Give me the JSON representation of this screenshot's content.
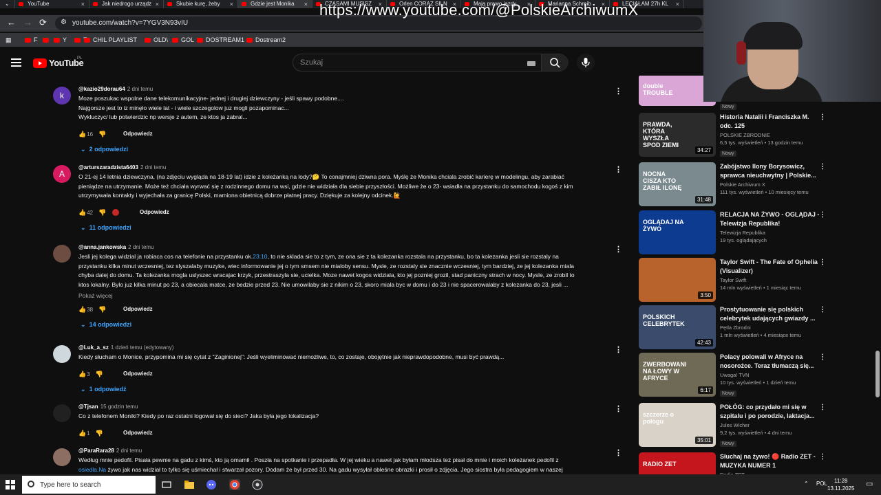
{
  "browser": {
    "tabs": [
      {
        "title": "YouTube",
        "active": false
      },
      {
        "title": "Jak niedrogo urządz",
        "active": false
      },
      {
        "title": "Skubie kurę, żeby",
        "active": false
      },
      {
        "title": "Gdzie jest Monika",
        "active": true
      },
      {
        "title": "CZASAMI MUSISZ",
        "active": false
      },
      {
        "title": "Orlen CORAZ SILN",
        "active": false
      },
      {
        "title": "Mają prawo jazdy",
        "active": false
      },
      {
        "title": "Marianna Schreib",
        "active": false
      },
      {
        "title": "LECIAŁAM 27h KL",
        "active": false
      }
    ],
    "url_overlay": "https://www.youtube.com/@PolskieArchiwumX",
    "address": "youtube.com/watch?v=7YGV3N93vIU",
    "bookmarks": [
      "F",
      "",
      "Y",
      "T",
      "CHIL PLAYLIST",
      "OLD\\",
      "GOL",
      "DOSTREAM1",
      "Dostream2"
    ]
  },
  "youtube": {
    "logo_text": "YouTube",
    "logo_region": "PL",
    "search_placeholder": "Szukaj"
  },
  "comments": [
    {
      "author": "@kazio29dorau64",
      "time": "2 dni temu",
      "avatar_letter": "k",
      "avatar_color": "#5e35b1",
      "lines": [
        "Moze poszukac wspolne dane telekomunikacyjne- jednej i drugiej dziewczyny - jeśli spawy podobne....",
        "Najgorsze jest to iz minęło wiele lat - i wiele szczegolow juz mogli pozapominac...",
        "Wykluczyc/ lub potwierdzic np wersje z autem, ze ktos ja zabral..."
      ],
      "likes": "16",
      "reply_label": "Odpowiedz",
      "replies": "2 odpowiedzi"
    },
    {
      "author": "@arturszaradzista6403",
      "time": "2 dni temu",
      "avatar_letter": "A",
      "avatar_color": "#d81b60",
      "lines": [
        "O 21-ej 14 letnia dziewczyna, (na zdjęciu wygląda na 18-19 lat) idzie z koleżanką na lody?🤔 To conajmniej dziwna pora. Myślę że Monika chciala zrobić karierę w modelingu, aby zarabiać",
        "pieniądze na utrzymanie. Może też chciała wyrwać się z rodzinnego domu na wsi, gdzie nie widziała dla siebie przyszłości. Możliwe że o 23- wsiadła na przystanku do  samochodu kogoś z kim",
        "utrzymywała kontakty i wyjechała za granicę Polski, mamiona obietnicą  dobrze płatnej pracy. Dziękuje za kolejny odcinek.🙋"
      ],
      "likes": "42",
      "reply_label": "Odpowiedz",
      "replies": "11 odpowiedzi"
    },
    {
      "author": "@anna.jankowska",
      "time": "2 dni temu",
      "avatar_letter": "",
      "avatar_color": "#6d4c41",
      "lines": [
        "Jesli jej kolega widzial ja robiaca cos na telefonie na przystanku ok.",
        "23:10",
        ", to nie sklada sie to z tym, ze ona sie z ta kolezanka rozstala na przystanku, bo ta kolezanka jesli sie rozstaly na",
        "przystanku kilka minut wczesniej, tez  slyszalaby muzyke, wiec informowanie jej o tym smsem nie mialoby sensu. Mysle, ze rozstaly sie znacznie wczesniej, tym bardziej, ze jej kolezanka miala",
        "chyba dalej do domu. Ta kolezanka mogla uslyszec wracajac krzyk, przestraszyla sie, ucielka. Moze nawet kogos widziala, kto jej pozniej grozil, stad paniczny strach w nocy. Mysle, ze zrobil to",
        "ktos lokalny. Bylo juz kilka minut po 23, a obiecala matce, ze bedzie przed 23. Nie umowilaby sie z nikim o 23, skoro miala byc w domu i do 23 i nie spacerowalaby z kolezanka do 23, jesli ..."
      ],
      "more": "Pokaż więcej",
      "likes": "38",
      "reply_label": "Odpowiedz",
      "replies": "14 odpowiedzi"
    },
    {
      "author": "@Luk_a_sz",
      "time": "1 dzień temu (edytowany)",
      "avatar_letter": "",
      "avatar_color": "#cfd8dc",
      "lines": [
        "Kiedy słucham o Monice, przypomina mi się cytat z \"Zaginionej\": Jeśli wyeliminować niemożliwe, to, co zostaje, obojętnie jak nieprawdopodobne, musi być prawdą..."
      ],
      "likes": "3",
      "reply_label": "Odpowiedz",
      "replies": "1 odpowiedź"
    },
    {
      "author": "@Tjsan",
      "time": "15 godzin temu",
      "avatar_letter": "",
      "avatar_color": "#212121",
      "lines": [
        "Co z telefonem Moniki? Kiedy po raz ostatni logował się do sieci? Jaka była jego lokalizacja?"
      ],
      "likes": "1",
      "reply_label": "Odpowiedz",
      "replies": ""
    },
    {
      "author": "@ParaRara28",
      "time": "2 dni temu",
      "avatar_letter": "",
      "avatar_color": "#8d6e63",
      "lines": [
        "Według mnie pedofil.  Pisała pewnie na gadu z kimś, kto ją omamił . Poszła na spotkanie i przepadła. W jej wieku a nawet jak byłam młodsza też pisał do mnie i moich koleżanek pedofil z",
        "osiedla.Na",
        " żywo jak nas widział to tylko się uśmiechał i stwarzał pozory. Dodam że był przed 30. Na gadu wysyłał obleśne obrazki i prosił o zdjęcia. Jego siostra była pedagogiem w naszej"
      ],
      "likes": "",
      "reply_label": "",
      "replies": ""
    }
  ],
  "sidebar": [
    {
      "title": "",
      "channel": "",
      "meta": "",
      "badge": "Nowy",
      "duration": "",
      "thumb_caption": "double TROUBLE",
      "thumb_color": "#d9a6d6"
    },
    {
      "title": "Historia Natalii i Franciszka M. odc. 125",
      "channel": "POLSKIE ZBRODNIE",
      "meta": "6,5 tys. wyświetleń • 13 godzin temu",
      "badge": "Nowy",
      "duration": "34:27",
      "thumb_caption": "PRAWDA, KTÓRA WYSZŁA SPOD ZIEMI",
      "thumb_color": "#2b2b2b"
    },
    {
      "title": "Zabójstwo Ilony Borysowicz, sprawca nieuchwytny | Polskie...",
      "channel": "Polskie Archiwum X",
      "meta": "111 tys. wyświetleń • 10 miesięcy temu",
      "badge": "",
      "duration": "31:48",
      "thumb_caption": "NOCNA CISZA KTO ZABIŁ ILONĘ",
      "thumb_color": "#7a8a8f"
    },
    {
      "title": "RELACJA NA ŻYWO - OGLĄDAJ - Telewizja Republika!",
      "channel": "Telewizja Republika",
      "meta": "19 tys. oglądających",
      "badge": "",
      "duration": "",
      "thumb_caption": "OGLĄDAJ NA ŻYWO",
      "thumb_color": "#0d3b8f"
    },
    {
      "title": "Taylor Swift - The Fate of Ophelia (Visualizer)",
      "channel": "Taylor Swift",
      "meta": "14 mln wyświetleń • 1 miesiąc temu",
      "badge": "",
      "duration": "3:50",
      "thumb_caption": "",
      "thumb_color": "#b8622c"
    },
    {
      "title": "Prostytuowanie się polskich celebrytek udających gwiazdy ...",
      "channel": "Pętla Zbrodni",
      "meta": "1 mln wyświetleń • 4 miesiące temu",
      "badge": "",
      "duration": "42:43",
      "thumb_caption": "POLSKICH CELEBRYTEK",
      "thumb_color": "#3a4b6b"
    },
    {
      "title": "Polacy polowali w Afryce na nosorożce. Teraz tłumaczą się...",
      "channel": "Uwaga! TVN",
      "meta": "10 tys. wyświetleń • 1 dzień temu",
      "badge": "Nowy",
      "duration": "6:17",
      "thumb_caption": "ZWERBOWANI NA ŁOWY W AFRYCE",
      "thumb_color": "#6f6a55"
    },
    {
      "title": "POŁÓG: co przydało mi się w szpitalu i po porodzie, laktacja...",
      "channel": "Jules Wicher",
      "meta": "9,2 tys. wyświetleń • 4 dni temu",
      "badge": "Nowy",
      "duration": "35:01",
      "thumb_caption": "szczerze o połogu",
      "thumb_color": "#d8d2c8"
    },
    {
      "title": "Słuchaj na żywo! 🔴 Radio ZET - MUZYKA NUMER 1",
      "channel": "Radio ZET",
      "meta": "",
      "badge": "",
      "duration": "",
      "thumb_caption": "RADIO ZET",
      "thumb_color": "#c4161c"
    }
  ],
  "taskbar": {
    "search_placeholder": "Type here to search",
    "lang": "POL",
    "time": "11:28",
    "date": "13.11.2025"
  }
}
